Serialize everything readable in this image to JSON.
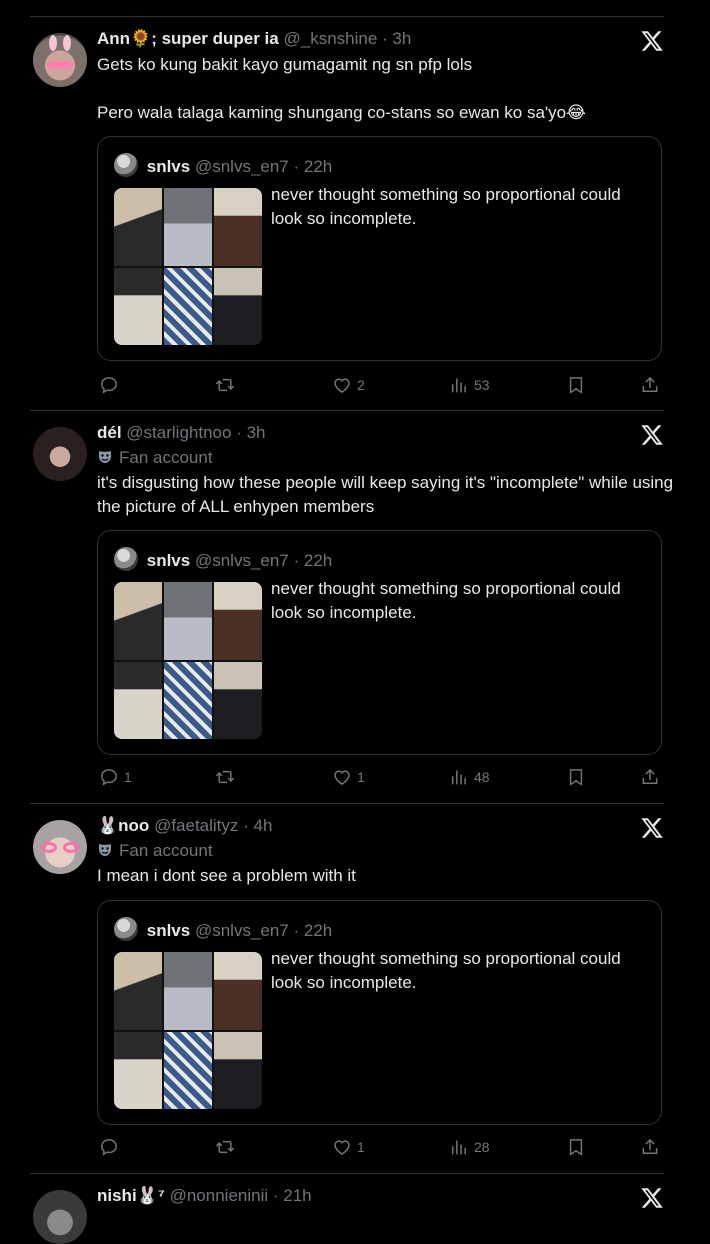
{
  "tweets": [
    {
      "name": "Ann🌻; super duper ia",
      "handle": "@_ksnshine",
      "time": "3h",
      "fan_label": "",
      "text": "Gets ko kung bakit kayo gumagamit ng sn pfp lols\n\nPero wala talaga kaming shungang co-stans so ewan ko sa'yo😂",
      "quote": {
        "name": "snlvs",
        "handle": "@snlvs_en7",
        "time": "22h",
        "text": "never thought something so proportional could look so incomplete."
      },
      "actions": {
        "replies": "",
        "retweets": "",
        "likes": "2",
        "views": "53"
      }
    },
    {
      "name": "dél",
      "handle": "@starlightnoo",
      "time": "3h",
      "fan_label": "Fan account",
      "text": "it's disgusting how these people will keep saying it's \"incomplete\" while using the picture of ALL enhypen members",
      "quote": {
        "name": "snlvs",
        "handle": "@snlvs_en7",
        "time": "22h",
        "text": "never thought something so proportional could look so incomplete."
      },
      "actions": {
        "replies": "1",
        "retweets": "",
        "likes": "1",
        "views": "48"
      }
    },
    {
      "name": "🐰noo",
      "handle": "@faetalityz",
      "time": "4h",
      "fan_label": "Fan account",
      "text": "I mean i dont see a problem with it",
      "quote": {
        "name": "snlvs",
        "handle": "@snlvs_en7",
        "time": "22h",
        "text": "never thought something so proportional could look so incomplete."
      },
      "actions": {
        "replies": "",
        "retweets": "",
        "likes": "1",
        "views": "28"
      }
    },
    {
      "name": "nishi🐰⁷",
      "handle": "@nonnieninii",
      "time": "21h"
    }
  ],
  "colors": {
    "background": "#000000",
    "text": "#e7e9ea",
    "muted": "#71767b",
    "border": "#2f3336"
  },
  "icons": [
    "x-logo-icon",
    "reply-icon",
    "retweet-icon",
    "like-icon",
    "views-icon",
    "bookmark-icon",
    "share-icon",
    "fan-mask-icon"
  ]
}
